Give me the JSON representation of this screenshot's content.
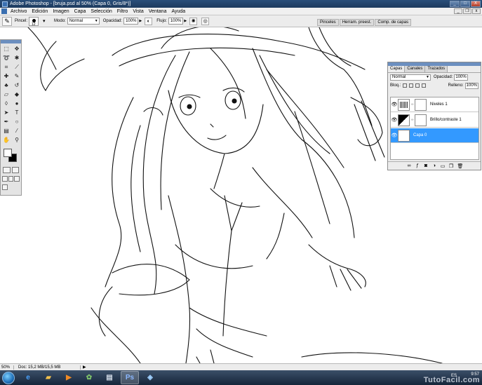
{
  "window": {
    "title": "Adobe Photoshop - [bruja.psd al 50% (Capa 0, Gris/8*)]",
    "buttons": {
      "minimize": "_",
      "maximize": "□",
      "close": "X"
    }
  },
  "menu": {
    "items": [
      "Archivo",
      "Edición",
      "Imagen",
      "Capa",
      "Selección",
      "Filtro",
      "Vista",
      "Ventana",
      "Ayuda"
    ],
    "doc_buttons": {
      "minimize": "_",
      "restore": "❐",
      "close": "x"
    }
  },
  "options": {
    "brush_label": "Pincel:",
    "brush_size": "12",
    "mode_label": "Modo:",
    "mode_value": "Normal",
    "opacity_label": "Opacidad:",
    "opacity_value": "100%",
    "flow_label": "Flujo:",
    "flow_value": "100%"
  },
  "palette_well": {
    "tabs": [
      "Pinceles",
      "Herram. preest.",
      "Comp. de capas"
    ]
  },
  "layers_panel": {
    "tabs": [
      "Capas",
      "Canales",
      "Trazados"
    ],
    "blend_mode": "Normal",
    "opacity_label": "Opacidad:",
    "opacity_value": "100%",
    "lock_label": "Bloq.:",
    "fill_label": "Relleno:",
    "fill_value": "100%",
    "layers": [
      {
        "name": "Niveles 1",
        "type": "levels"
      },
      {
        "name": "Brillo/contraste 1",
        "type": "brightness-contrast"
      },
      {
        "name": "Capa 0",
        "type": "pixel",
        "selected": true
      }
    ]
  },
  "status": {
    "zoom": "50%",
    "doc_info": "Doc: 15,2 MB/15,5 MB"
  },
  "taskbar": {
    "language": "ES",
    "time": "9:57"
  },
  "watermark": "TutoFacil.com",
  "colors": {
    "titlebar": "#1d3a5e",
    "selection": "#3399ff",
    "panel_bg": "#ececec"
  }
}
